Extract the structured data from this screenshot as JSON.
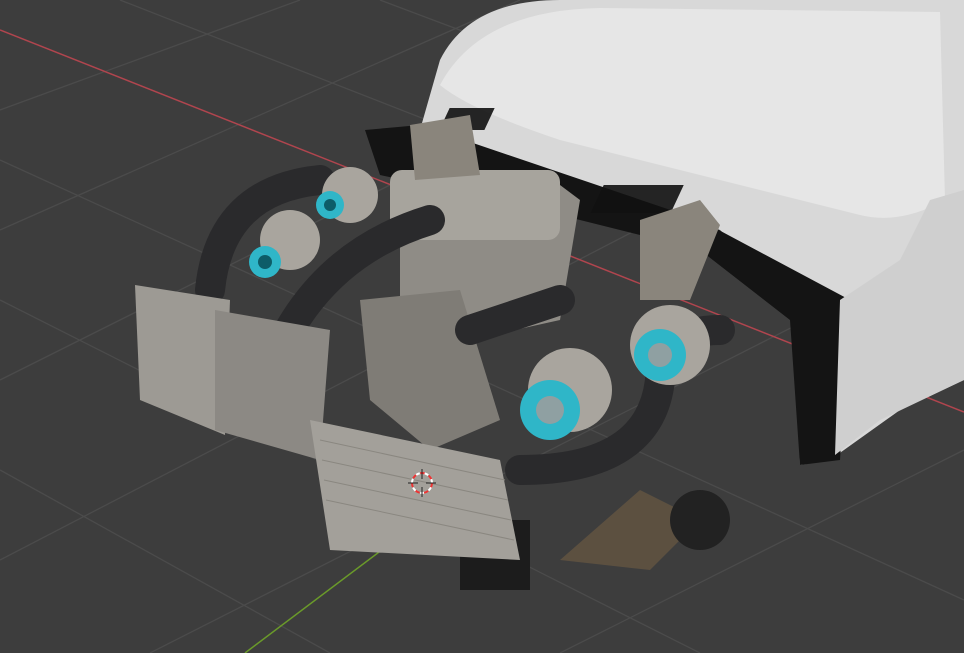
{
  "viewport": {
    "background_color": "#3d3d3d",
    "grid_color": "#4a4a4a",
    "x_axis_color": "#b0454e",
    "y_axis_color": "#6a9a2a"
  },
  "model": {
    "body_color": "#dcdcdc",
    "metal_color": "#9a9790",
    "carbon_color": "#2a2a2c",
    "turbo_accent_color": "#2fb6c8"
  },
  "cursor": {
    "icon": "3d-cursor-icon"
  }
}
